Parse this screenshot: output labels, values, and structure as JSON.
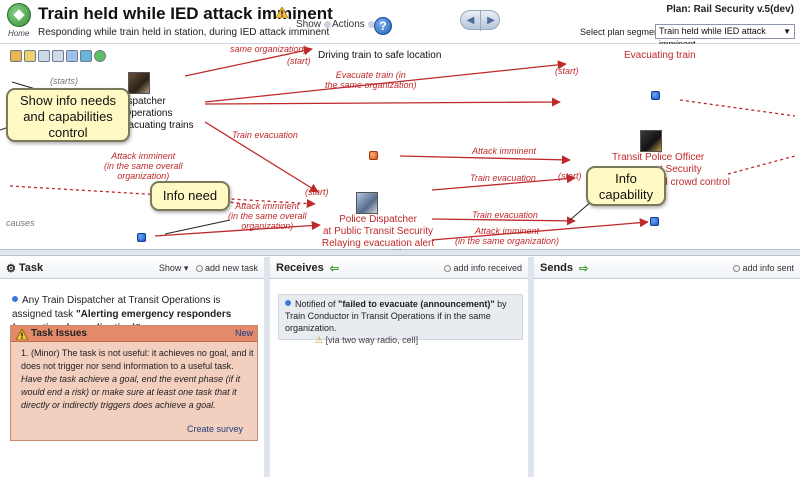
{
  "header": {
    "logo_label": "Home",
    "title": "Train held while IED attack imminent",
    "subtitle": "Responding while train held in station, during IED attack imminent",
    "menus": [
      "Show",
      "Actions"
    ],
    "help": "?",
    "plan": "Plan: Rail Security v.5(dev)",
    "segment_label": "Select plan segment:",
    "segment_value": "Train held while IED attack imminent"
  },
  "map": {
    "nodes": {
      "dispatcher_top": [
        "Dispatcher",
        "t Operations",
        "evacuating trains"
      ],
      "driving_train": "Driving train to safe location",
      "evacuating_train": "Evacuating train",
      "police_dispatcher": [
        "Police Dispatcher",
        "at Public Transit Security",
        "Relaying evacuation alert"
      ],
      "transit_police": [
        "Transit Police Officer",
        "t Security",
        "and crowd control"
      ],
      "transit_police_a": "A"
    },
    "labels": {
      "same_org_top": "same organization)",
      "start1": "(start)",
      "start2": "(start)",
      "start3": "(start)",
      "start4": "(start)",
      "starts": "(starts)",
      "evacuate_train": [
        "Evacuate train (in",
        "the same organization)"
      ],
      "train_evacuation1": "Train evacuation",
      "attack_imminent_overall": [
        "Attack imminent",
        "(in the same overall",
        "organization)"
      ],
      "attack_imminent_center": "Attack imminent",
      "train_evacuation2": "Train evacuation",
      "attack_imminent_overall2": [
        "Attack imminent",
        "(in the same overall",
        "organization)"
      ],
      "train_evacuation3": "Train evacuation",
      "attack_imminent_same": [
        "Attack imminent",
        "(in the same organization)"
      ],
      "causes": "causes"
    },
    "callouts": {
      "info_needs": [
        "Show info needs",
        "and capabilities",
        "control"
      ],
      "info_need": "Info need",
      "info_capability": [
        "Info",
        "capability"
      ]
    }
  },
  "task_panel": {
    "title": "Task",
    "show": "Show",
    "add": "add new task",
    "assignment_prefix": "Any Train Dispatcher at Transit Operations is assigned task",
    "assignment_task": "\"Alerting emergency responders (operational coordination)\"",
    "assignment_suffix": ".",
    "issues_title": "Task Issues",
    "issues_new": "New",
    "issue_prefix": "1. (Minor) The task is not useful: it achieves no goal, and it does not trigger nor send information to a useful task.",
    "issue_hint": "Have the task achieve a goal, end the event phase (if it would end a risk) or make sure at least one task that it directly or indirectly triggers does achieve a goal.",
    "create_survey": "Create survey"
  },
  "receives_panel": {
    "title": "Receives",
    "add": "add info received",
    "notified_prefix": "Notified of",
    "notified_info": "\"failed to evacuate (announcement)\"",
    "notified_suffix": "by Train Conductor in Transit Operations if in the same organization.",
    "via": "[via two way radio, cell]"
  },
  "sends_panel": {
    "title": "Sends",
    "add": "add info sent"
  },
  "colors": {
    "flow_red": "#c0292b",
    "callout_fill": "#fff9c4",
    "issues_fill": "#f3cfbf",
    "issues_head": "#e28a6a",
    "accent_blue": "#1d55c4"
  }
}
